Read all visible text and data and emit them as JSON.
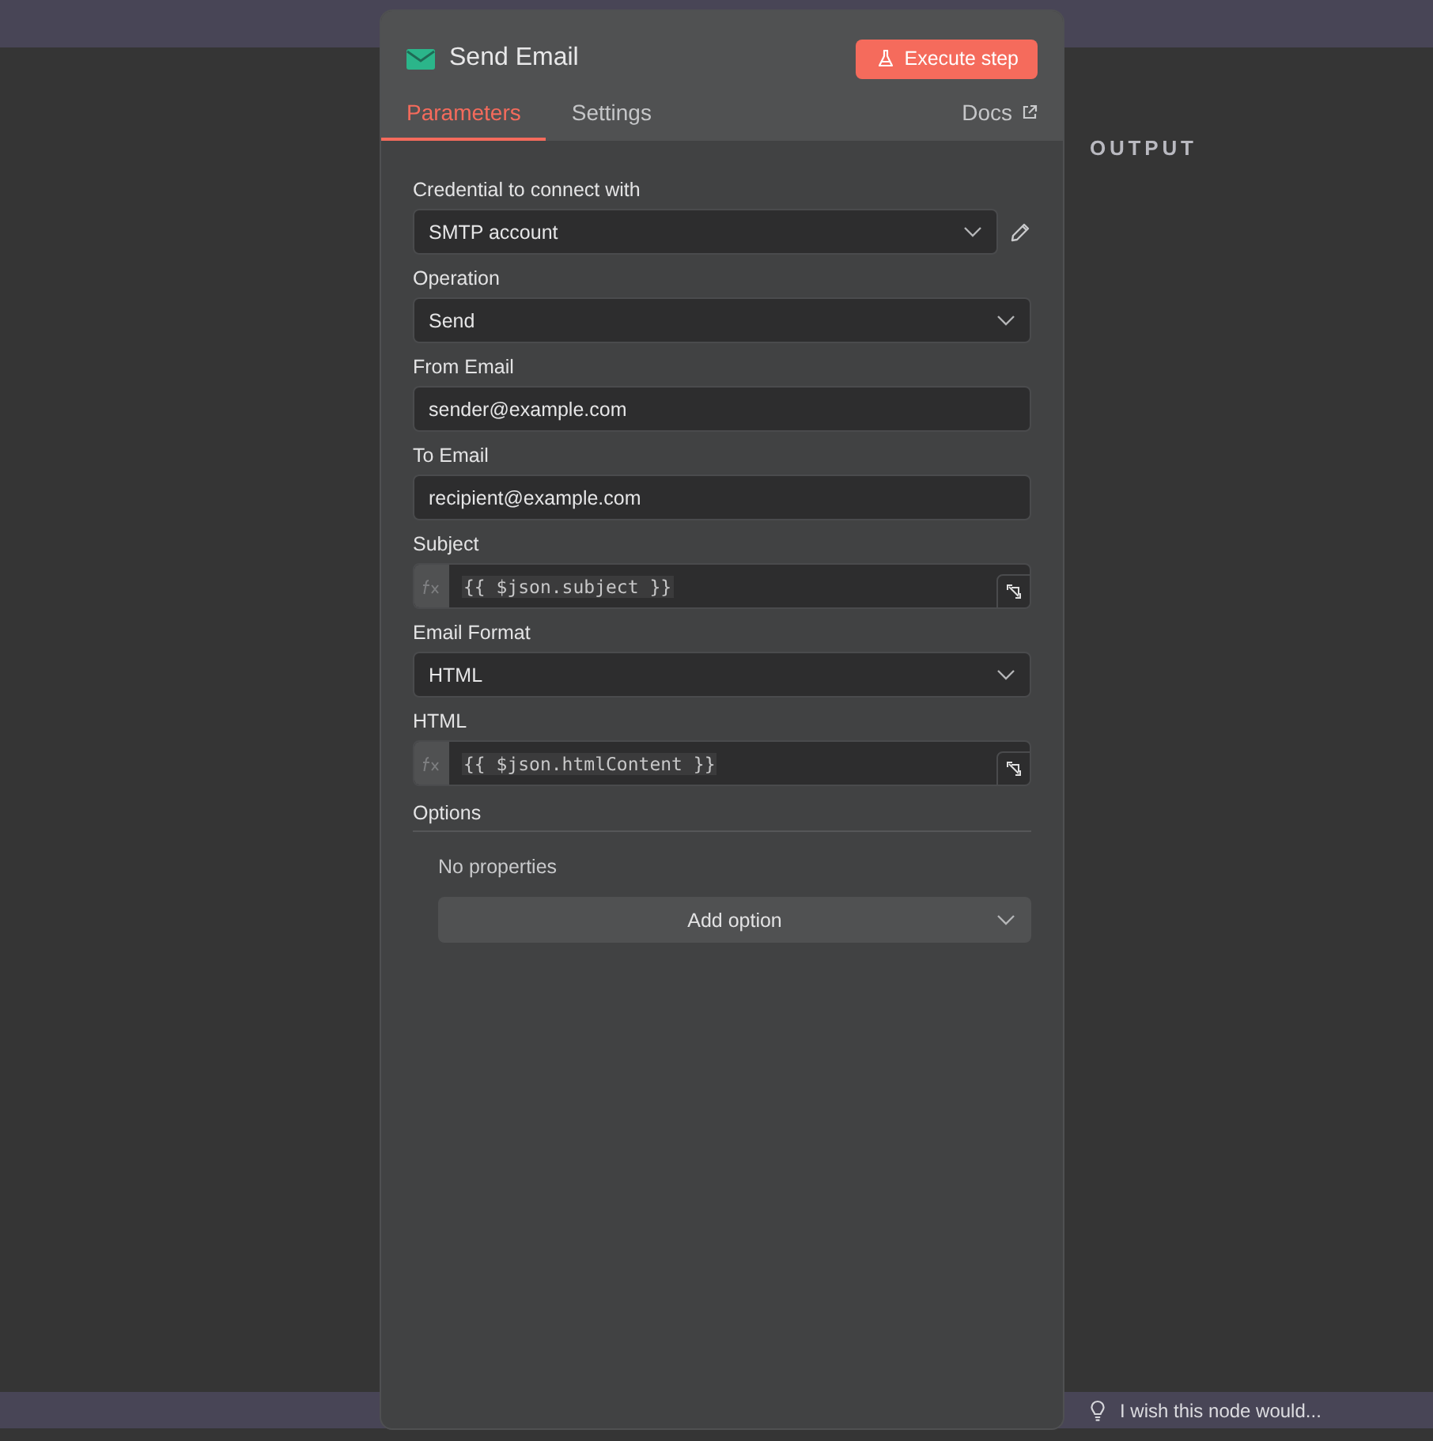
{
  "node": {
    "title": "Send Email",
    "execute_button": "Execute step"
  },
  "tabs": [
    {
      "label": "Parameters",
      "selected": true
    },
    {
      "label": "Settings",
      "selected": false
    }
  ],
  "docs_link": "Docs",
  "fields": [
    {
      "kind": "select",
      "label": "Credential to connect with",
      "value": "SMTP account",
      "editable": true
    },
    {
      "kind": "select",
      "label": "Operation",
      "value": "Send",
      "editable": false
    },
    {
      "kind": "input",
      "label": "From Email",
      "value": "sender@example.com"
    },
    {
      "kind": "input",
      "label": "To Email",
      "value": "recipient@example.com"
    },
    {
      "kind": "expression",
      "label": "Subject",
      "value": "{{ $json.subject }}"
    },
    {
      "kind": "select",
      "label": "Email Format",
      "value": "HTML",
      "editable": false
    },
    {
      "kind": "expression",
      "label": "HTML",
      "value": "{{ $json.htmlContent }}"
    }
  ],
  "options": {
    "title": "Options",
    "empty_text": "No properties",
    "add_button": "Add option"
  },
  "output_label": "OUTPUT",
  "feedback": "I wish this node would..."
}
